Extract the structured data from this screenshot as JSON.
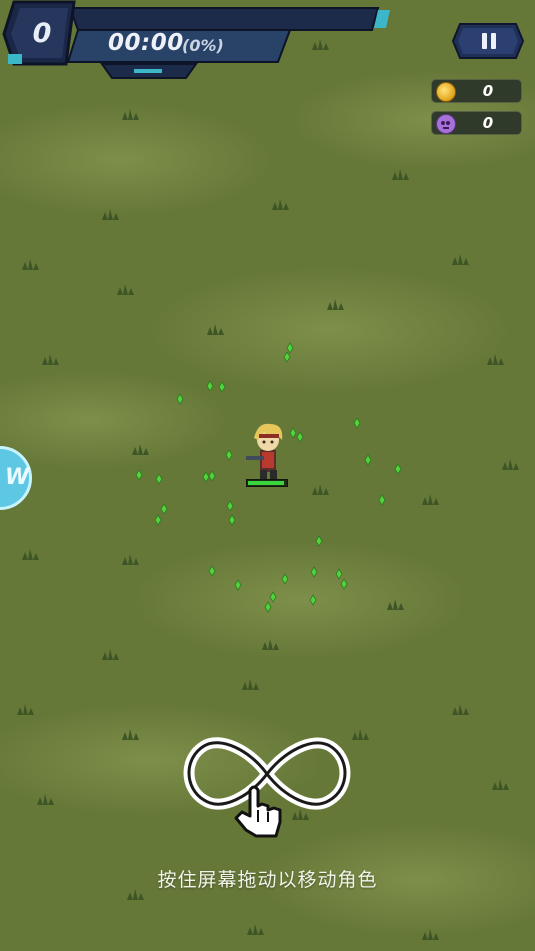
{
  "hud": {
    "kill_count": "0",
    "timer": "00:00",
    "timer_pct": "(0%)"
  },
  "counters": {
    "coins": "0",
    "kills": "0"
  },
  "player": {
    "hp_fraction": 0.95
  },
  "tutorial": {
    "hint": "按住屏幕拖动以移动角色"
  },
  "colors": {
    "ground": "#667838",
    "gem": "#52d23c",
    "hud_dark": "#1c2a48",
    "hud_blue": "#3d5a8a"
  },
  "icons": {
    "pause": "pause-icon",
    "coin": "coin-icon",
    "kill": "skull-icon",
    "gesture": "infinity-drag-gesture-icon"
  }
}
